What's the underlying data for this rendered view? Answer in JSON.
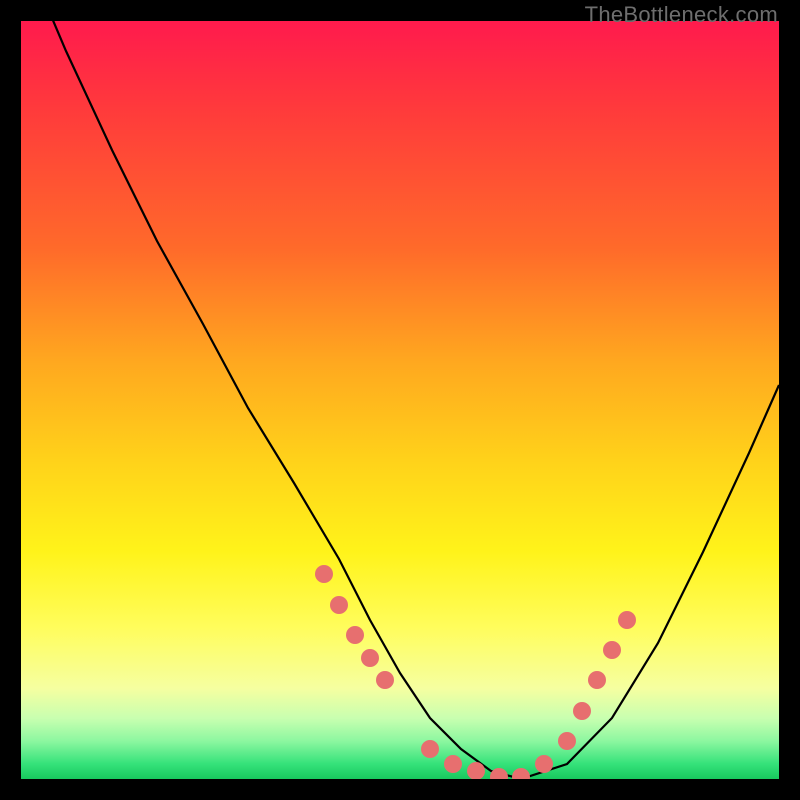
{
  "watermark": {
    "text": "TheBottleneck.com"
  },
  "colors": {
    "curve": "#000000",
    "markers": "#e76f6f",
    "gradient_top": "#ff1a4d",
    "gradient_bottom": "#18c85e",
    "frame": "#000000"
  },
  "chart_data": {
    "type": "line",
    "title": "",
    "xlabel": "",
    "ylabel": "",
    "xlim": [
      0,
      100
    ],
    "ylim": [
      0,
      100
    ],
    "grid": false,
    "legend": false,
    "series": [
      {
        "name": "bottleneck-curve",
        "x": [
          0,
          6,
          12,
          18,
          24,
          30,
          36,
          42,
          46,
          50,
          54,
          58,
          62,
          66,
          72,
          78,
          84,
          90,
          96,
          100
        ],
        "y": [
          110,
          96,
          83,
          71,
          60,
          49,
          39,
          29,
          21,
          14,
          8,
          4,
          1,
          0,
          2,
          8,
          18,
          30,
          43,
          52
        ],
        "note": "approximate V-shaped bottleneck curve; y≈0 is optimal (bottom of plot)"
      }
    ],
    "markers": {
      "name": "highlighted-near-optimal-segments",
      "note": "pink dot clusters along curve near the trough and on both rising walls",
      "points": [
        {
          "x": 40,
          "y": 27
        },
        {
          "x": 42,
          "y": 23
        },
        {
          "x": 44,
          "y": 19
        },
        {
          "x": 46,
          "y": 16
        },
        {
          "x": 48,
          "y": 13
        },
        {
          "x": 54,
          "y": 4
        },
        {
          "x": 57,
          "y": 2
        },
        {
          "x": 60,
          "y": 1
        },
        {
          "x": 63,
          "y": 0
        },
        {
          "x": 66,
          "y": 0
        },
        {
          "x": 69,
          "y": 2
        },
        {
          "x": 72,
          "y": 5
        },
        {
          "x": 74,
          "y": 9
        },
        {
          "x": 76,
          "y": 13
        },
        {
          "x": 78,
          "y": 17
        },
        {
          "x": 80,
          "y": 21
        }
      ]
    }
  }
}
